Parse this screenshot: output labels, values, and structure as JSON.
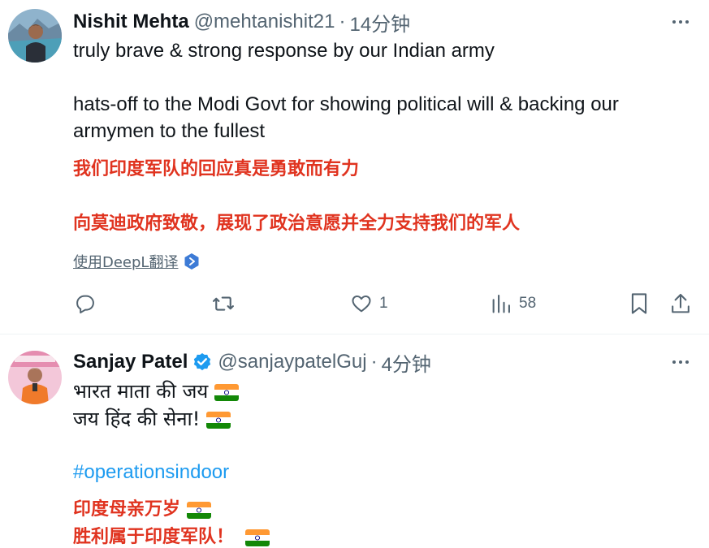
{
  "tweets": [
    {
      "name": "Nishit Mehta",
      "handle": "@mehtanishit21",
      "separator": "·",
      "time": "14分钟",
      "lines": [
        "truly brave & strong response by our Indian army",
        "hats-off to the Modi Govt for showing political will & backing our",
        "armymen to the fullest"
      ],
      "translation_lines": [
        "我们印度军队的回应真是勇敢而有力",
        "向莫迪政府致敬，展现了政治意愿并全力支持我们的军人"
      ],
      "translate_link": "使用DeepL翻译",
      "actions": {
        "reply_count": "",
        "retweet_count": "",
        "like_count": "1",
        "views_count": "58"
      }
    },
    {
      "name": "Sanjay Patel",
      "verified": true,
      "handle": "@sanjaypatelGuj",
      "separator": "·",
      "time": "4分钟",
      "lines": [
        "भारत माता की जय",
        "जय हिंद की सेना!"
      ],
      "hashtag": "#operationsindoor",
      "translation_lines": [
        "印度母亲万岁",
        "胜利属于印度军队！"
      ]
    }
  ],
  "colors": {
    "text": "#0f1419",
    "secondary": "#536471",
    "link_blue": "#1d9bf0",
    "translation_red": "#e0331f",
    "divider": "#eff3f4"
  },
  "icons": {
    "more": "more-dots-icon",
    "reply": "reply-icon",
    "retweet": "retweet-icon",
    "like": "heart-icon",
    "views": "views-chart-icon",
    "bookmark": "bookmark-icon",
    "share": "share-icon",
    "verified": "verified-badge-icon",
    "flag": "india-flag-icon",
    "deepl": "deepl-icon"
  }
}
